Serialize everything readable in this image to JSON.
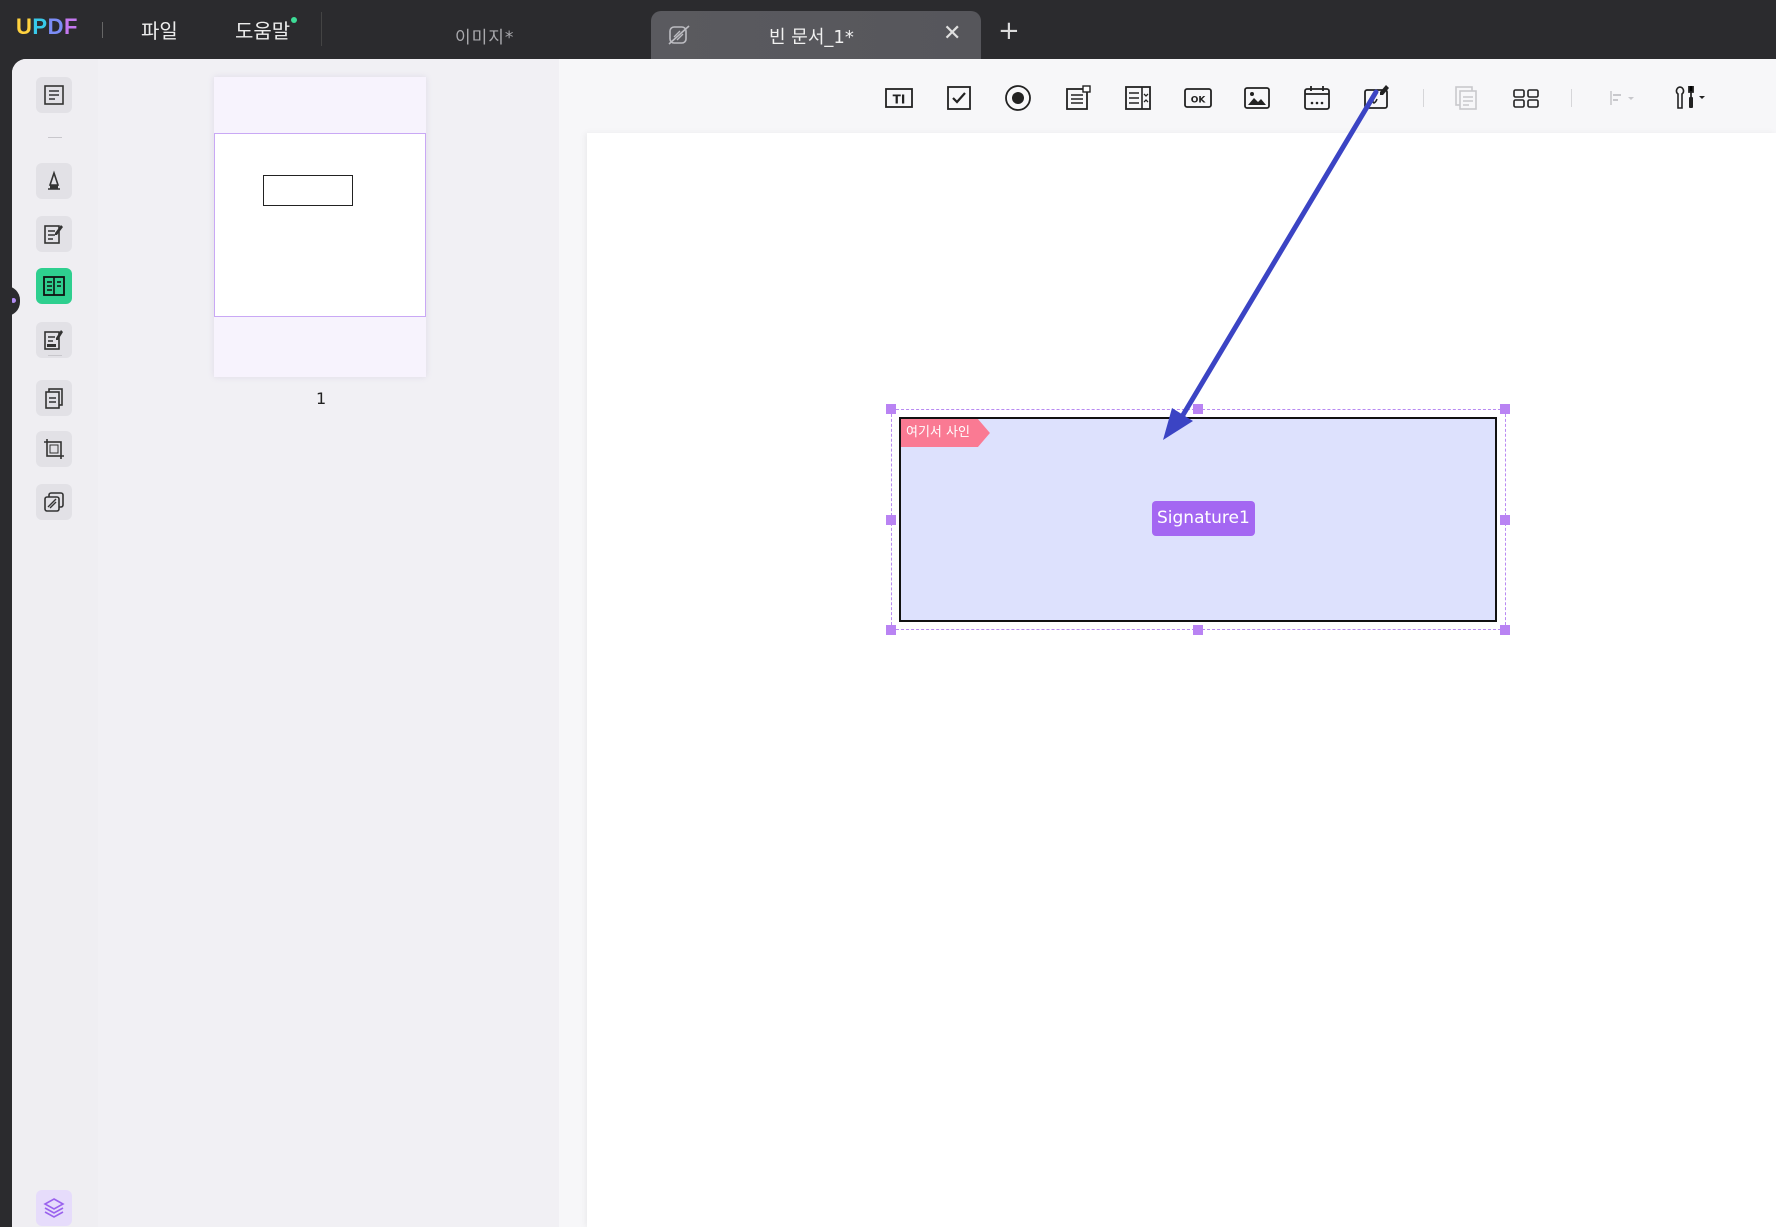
{
  "app": {
    "logo": {
      "u": "U",
      "p": "P",
      "d": "D",
      "f": "F"
    },
    "menu": {
      "file": "파일",
      "help": "도움말"
    }
  },
  "tabs": {
    "inactive_label": "이미지*",
    "active_label": "빈 문서_1*",
    "close_symbol": "✕",
    "add_symbol": "+"
  },
  "thumbnails": {
    "page_number": "1"
  },
  "signature_field": {
    "tag_label": "여기서 사인",
    "name": "Signature1"
  },
  "colors": {
    "accent_purple": "#a467f2",
    "active_tool_green": "#2ecf8f",
    "arrow_blue": "#3b44c4",
    "sign_tag": "#fa7a93"
  },
  "toolbar_icons": [
    "text-field-icon",
    "checkbox-icon",
    "radio-button-icon",
    "combo-box-icon",
    "list-box-icon",
    "button-icon",
    "image-field-icon",
    "date-field-icon",
    "signature-field-icon",
    "duplicate-icon",
    "grid-layout-icon",
    "align-icon",
    "tools-icon"
  ]
}
